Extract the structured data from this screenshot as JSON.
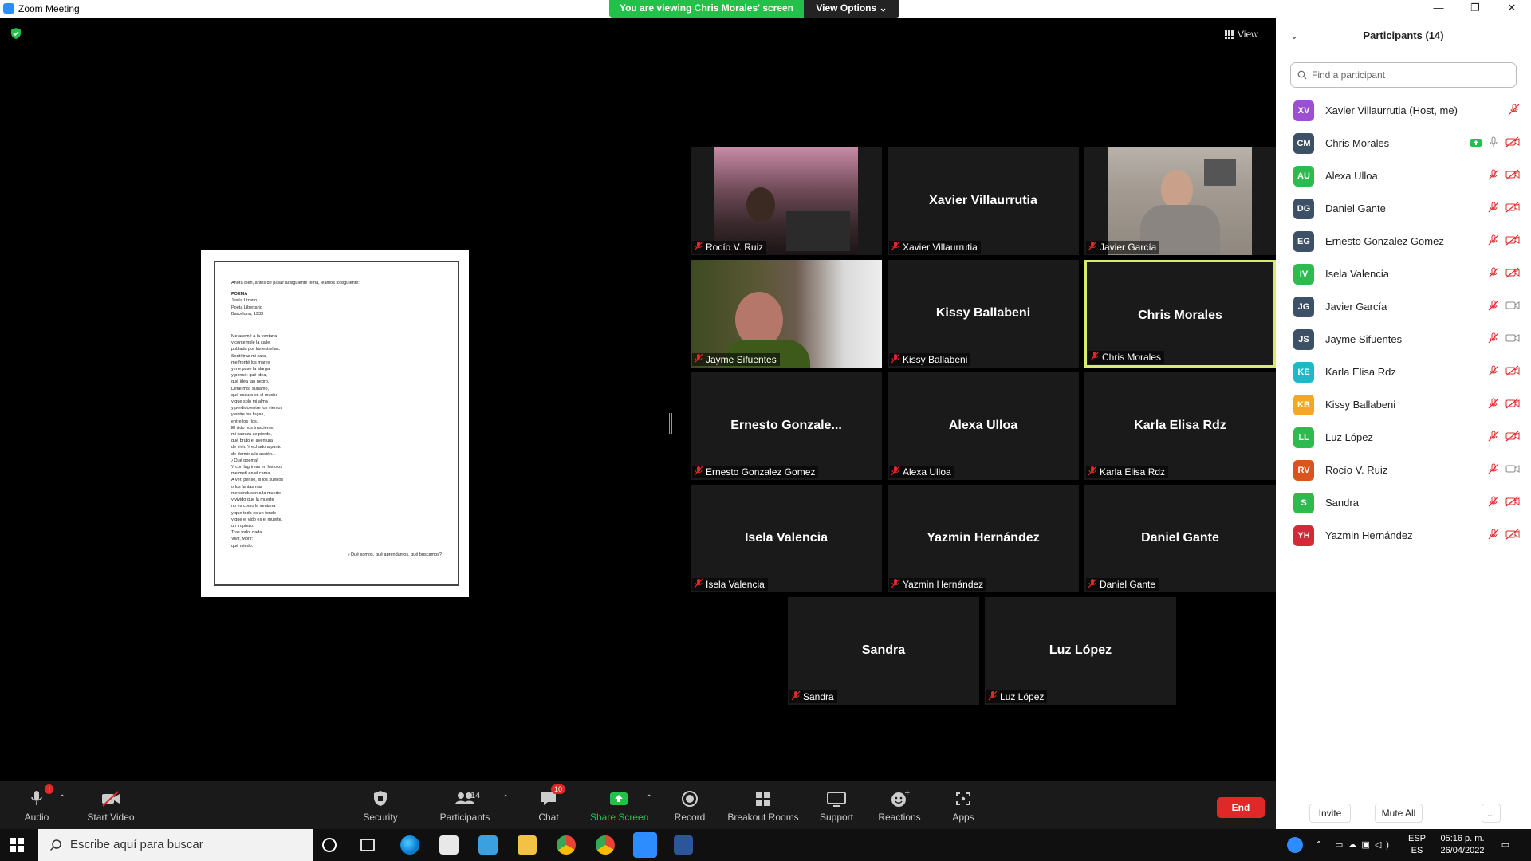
{
  "window": {
    "title": "Zoom Meeting",
    "sharing_banner": "You are viewing Chris Morales' screen",
    "view_options": "View Options"
  },
  "meeting": {
    "view_label": "View"
  },
  "shared_document": {
    "intro": "Ahora bien, antes de pasar al siguiente tema, leamos lo siguiente:",
    "heading": [
      "POEMA",
      "Jesús Lizano,",
      "Poeta Libertario",
      "Barcelona, 1933"
    ],
    "lines": [
      "Me asomé a la ventana",
      "y contemplé la calle",
      "poblada por las estrellas.",
      "Sentí tras mi cara,",
      "me fronté los mares",
      "y me puse la alarga",
      "y pensé: qué idea,",
      "qué idea tan negro.",
      "Dime mis, sudamo,",
      "qué oscuro es el mucho",
      "y que solo mi alma",
      "y perdido entre los vientos",
      "y entre las fugas,",
      "entre los ríos,",
      "El vido nos trasciente,",
      "mi cabeza se pierde,",
      "qué bruto el aventura",
      "de vivir. Y echado a punto",
      "de dormir a la acción...",
      "¿Qué poema!",
      "Y con lágrimas en los ojos",
      "me metí en el cama.",
      "A ver, pensé, si los sueños",
      "o los fantasmas",
      "me conducen a la muerte",
      "y vivido que la muerte",
      "no es como la ventana",
      "y que todo es un fondo",
      "y que el vido es el muerte,",
      "un tropiezo.",
      "Tras todo, nada.",
      "Vivir, Morir:",
      "qué miedo."
    ],
    "bottom_right": "¿Qué somos, qué aprendamos, qué buscamos?"
  },
  "tiles": [
    {
      "display": "",
      "label": "Rocío V. Ruiz",
      "video": "a"
    },
    {
      "display": "Xavier Villaurrutia",
      "label": "Xavier Villaurrutia",
      "video": ""
    },
    {
      "display": "",
      "label": "Javier García",
      "video": "b"
    },
    {
      "display": "",
      "label": "Jayme Sifuentes",
      "video": "c"
    },
    {
      "display": "Kissy Ballabeni",
      "label": "Kissy Ballabeni",
      "video": ""
    },
    {
      "display": "Chris Morales",
      "label": "Chris Morales",
      "video": "",
      "active": true
    },
    {
      "display": "Ernesto  Gonzale...",
      "label": "Ernesto Gonzalez Gomez",
      "video": ""
    },
    {
      "display": "Alexa Ulloa",
      "label": "Alexa Ulloa",
      "video": ""
    },
    {
      "display": "Karla Elisa Rdz",
      "label": "Karla Elisa Rdz",
      "video": ""
    },
    {
      "display": "Isela Valencia",
      "label": "Isela Valencia",
      "video": ""
    },
    {
      "display": "Yazmin Hernández",
      "label": "Yazmin Hernández",
      "video": ""
    },
    {
      "display": "Daniel Gante",
      "label": "Daniel Gante",
      "video": ""
    },
    {
      "display": "Sandra",
      "label": "Sandra",
      "video": ""
    },
    {
      "display": "Luz López",
      "label": "Luz López",
      "video": ""
    }
  ],
  "toolbar": {
    "audio": "Audio",
    "audio_badge": "!",
    "start_video": "Start Video",
    "security": "Security",
    "participants": "Participants",
    "participants_count": "14",
    "chat": "Chat",
    "chat_badge": "10",
    "share_screen": "Share Screen",
    "record": "Record",
    "breakout_rooms": "Breakout Rooms",
    "support": "Support",
    "reactions": "Reactions",
    "apps": "Apps",
    "end": "End"
  },
  "participants_panel": {
    "title": "Participants (14)",
    "search_placeholder": "Find a participant",
    "invite": "Invite",
    "mute_all": "Mute All",
    "more": "...",
    "participants": [
      {
        "initials": "XV",
        "name": "Xavier Villaurrutia (Host, me)",
        "color": "#9b4fd1",
        "mic": "muted",
        "video": "none",
        "sharing": false
      },
      {
        "initials": "CM",
        "name": "Chris Morales",
        "color": "#3c5166",
        "mic": "on",
        "video": "off",
        "sharing": true
      },
      {
        "initials": "AU",
        "name": "Alexa Ulloa",
        "color": "#2dbb4f",
        "mic": "muted",
        "video": "off",
        "sharing": false
      },
      {
        "initials": "DG",
        "name": "Daniel Gante",
        "color": "#3c5166",
        "mic": "muted",
        "video": "off",
        "sharing": false
      },
      {
        "initials": "EG",
        "name": "Ernesto Gonzalez Gomez",
        "color": "#3c5166",
        "mic": "muted",
        "video": "off",
        "sharing": false
      },
      {
        "initials": "IV",
        "name": "Isela Valencia",
        "color": "#2dbb4f",
        "mic": "muted",
        "video": "off",
        "sharing": false
      },
      {
        "initials": "JG",
        "name": "Javier García",
        "color": "#3c5166",
        "mic": "muted",
        "video": "on",
        "sharing": false
      },
      {
        "initials": "JS",
        "name": "Jayme Sifuentes",
        "color": "#3c5166",
        "mic": "muted",
        "video": "on",
        "sharing": false
      },
      {
        "initials": "KE",
        "name": "Karla Elisa Rdz",
        "color": "#1fb8c9",
        "mic": "muted",
        "video": "off",
        "sharing": false
      },
      {
        "initials": "KB",
        "name": "Kissy Ballabeni",
        "color": "#f5a623",
        "mic": "muted",
        "video": "off",
        "sharing": false
      },
      {
        "initials": "LL",
        "name": "Luz López",
        "color": "#2dbb4f",
        "mic": "muted",
        "video": "off",
        "sharing": false
      },
      {
        "initials": "RV",
        "name": "Rocío V. Ruiz",
        "color": "#d9541e",
        "mic": "muted",
        "video": "on",
        "sharing": false
      },
      {
        "initials": "S",
        "name": "Sandra",
        "color": "#2dbb4f",
        "mic": "muted",
        "video": "off",
        "sharing": false
      },
      {
        "initials": "YH",
        "name": "Yazmin Hernández",
        "color": "#d12b3a",
        "mic": "muted",
        "video": "off",
        "sharing": false
      }
    ]
  },
  "taskbar": {
    "search_placeholder": "Escribe aquí para buscar",
    "lang_top": "ESP",
    "lang_bottom": "ES",
    "time": "05:16 p. m.",
    "date": "26/04/2022"
  },
  "colors": {
    "zoom_blue": "#2d8cff",
    "share_green": "#23c14a",
    "end_red": "#e02828",
    "active_speaker": "#d9ec6a"
  }
}
